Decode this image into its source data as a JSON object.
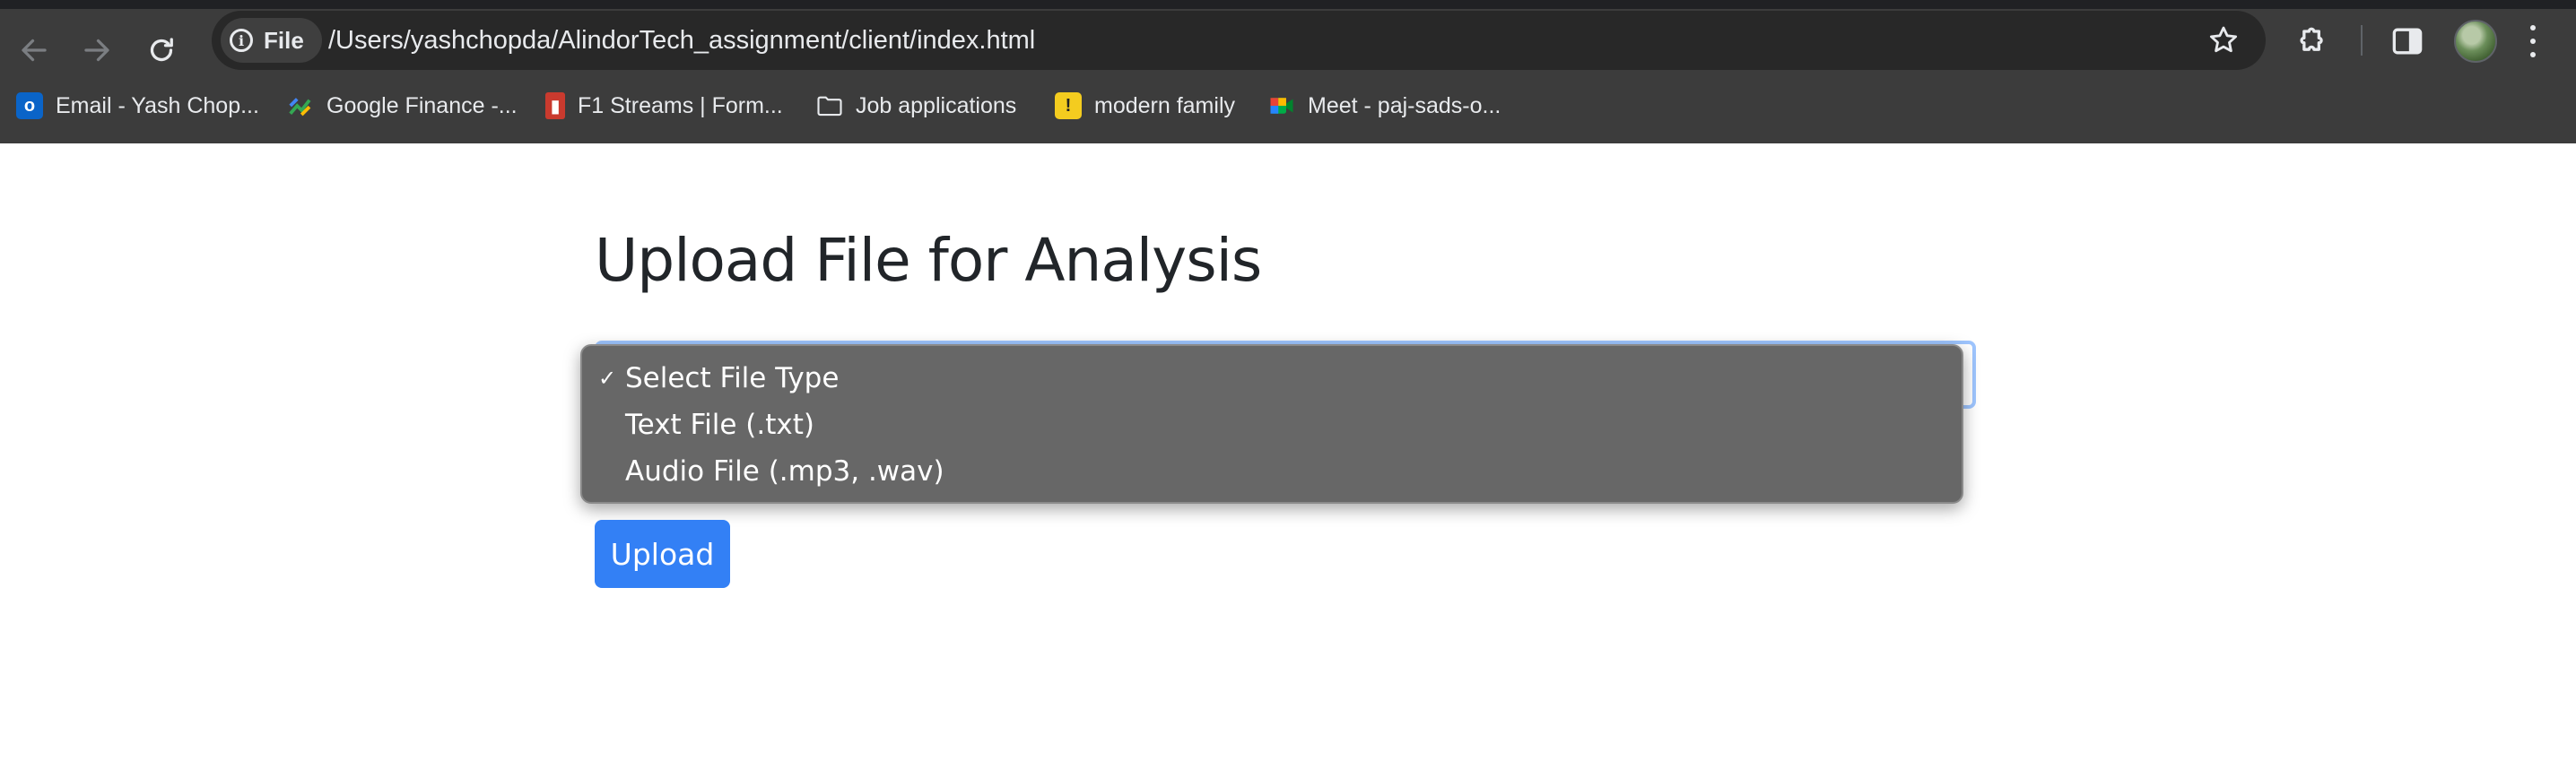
{
  "browser": {
    "url_scheme_label": "File",
    "url": "/Users/yashchopda/AlindorTech_assignment/client/index.html"
  },
  "bookmarks": [
    {
      "label": "Email - Yash Chop...",
      "icon": "outlook-icon"
    },
    {
      "label": "Google Finance -...",
      "icon": "google-finance-icon"
    },
    {
      "label": "F1 Streams | Form...",
      "icon": "f1-icon"
    },
    {
      "label": "Job applications",
      "icon": "folder-icon"
    },
    {
      "label": "modern family",
      "icon": "exclamation-icon"
    },
    {
      "label": "Meet - paj-sads-o...",
      "icon": "google-meet-icon"
    }
  ],
  "page": {
    "title": "Upload File for Analysis",
    "file_type_select": {
      "selected": "Select File Type",
      "options": [
        "Select File Type",
        "Text File (.txt)",
        "Audio File (.mp3, .wav)"
      ],
      "check_mark": "✓"
    },
    "upload_label": "Upload"
  },
  "colors": {
    "accent": "#3380f5",
    "chrome_bg": "#3c3c3c",
    "dropdown_bg": "#676767",
    "select_focus": "#9ec5fe"
  }
}
